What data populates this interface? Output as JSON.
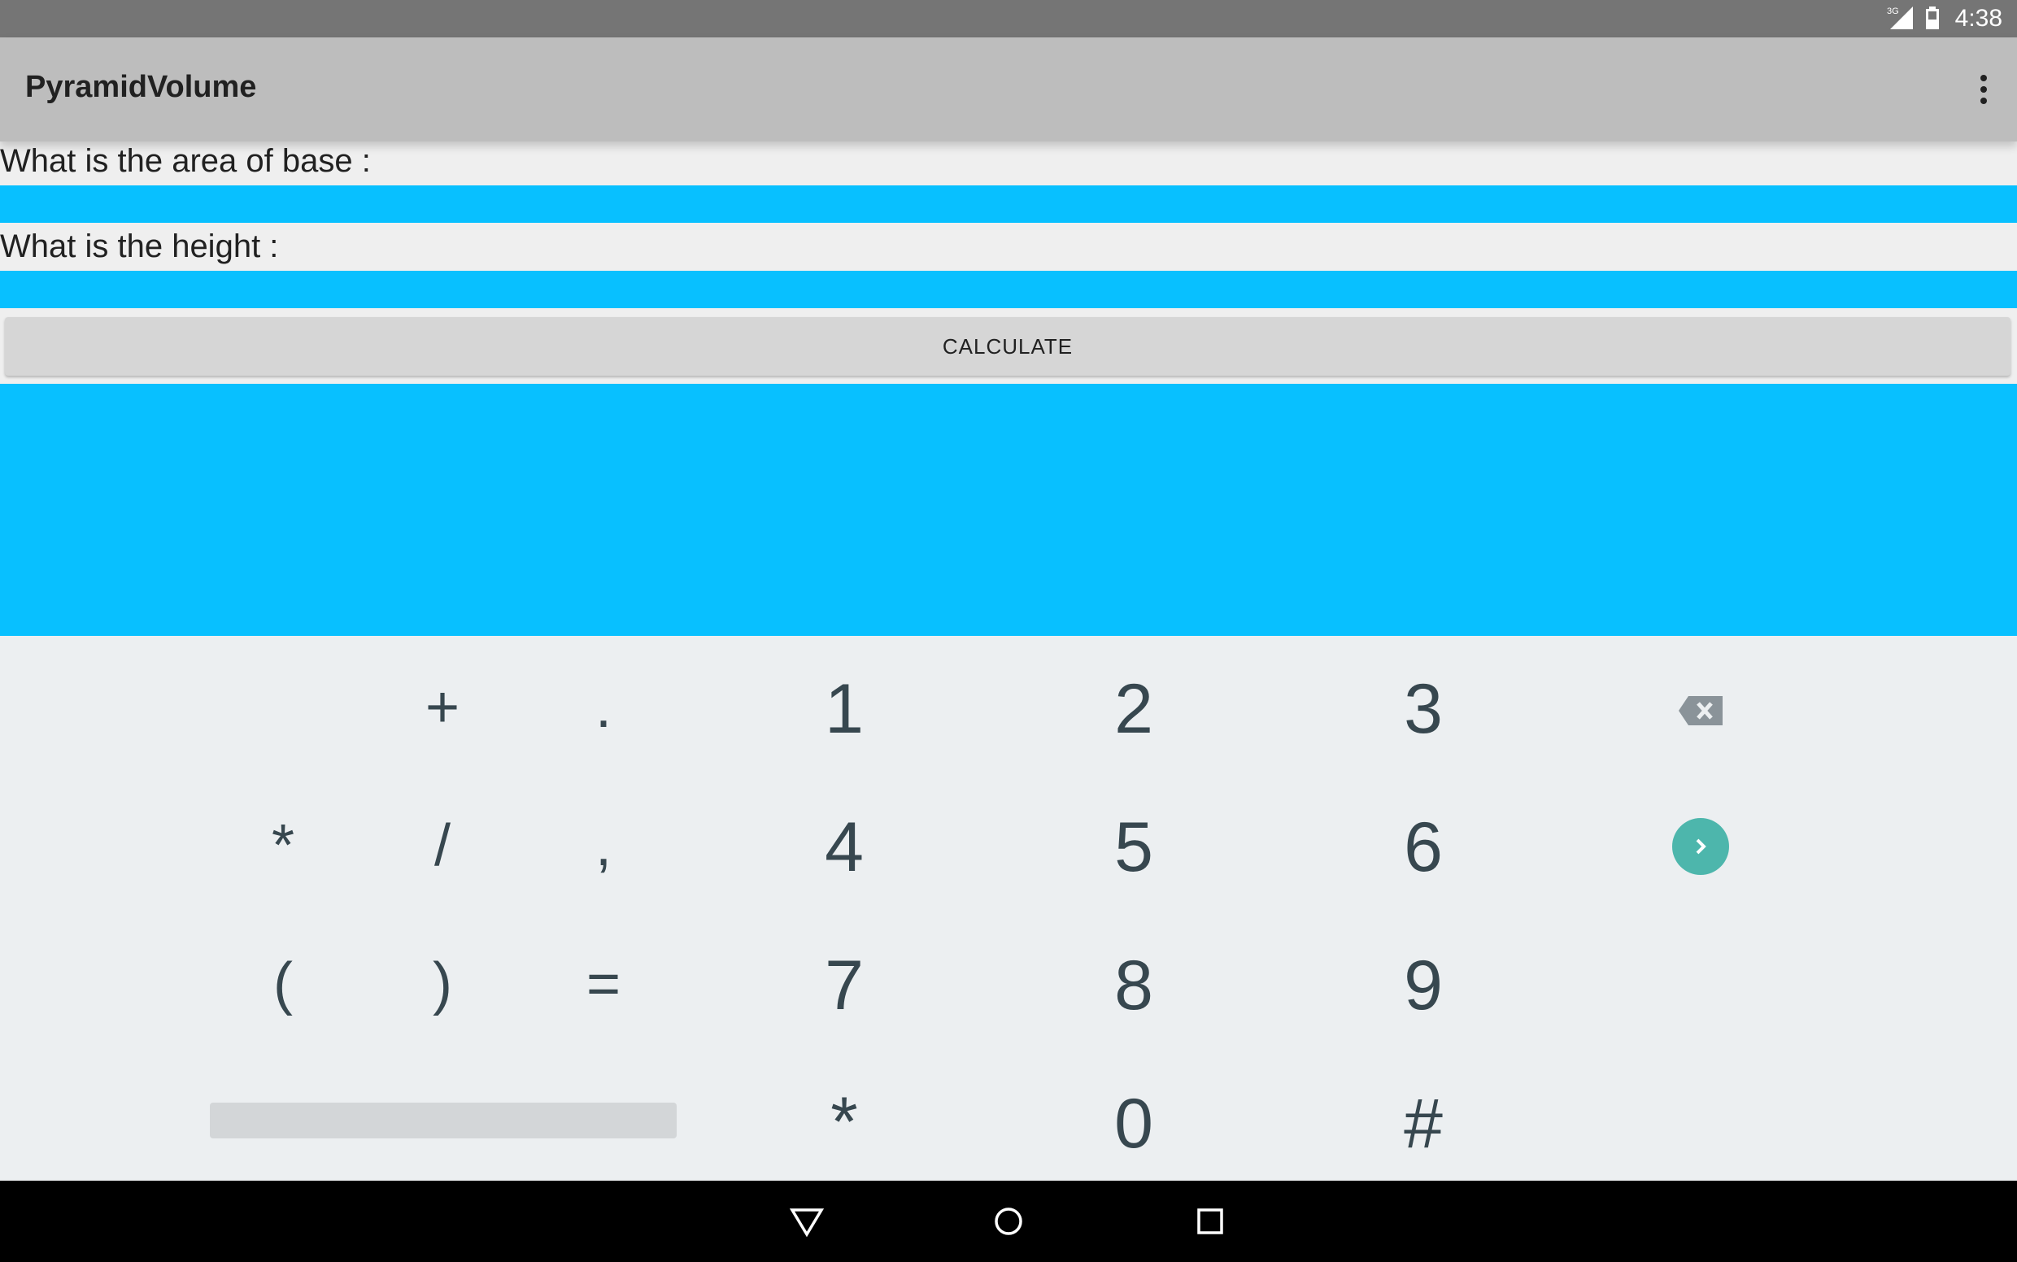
{
  "status_bar": {
    "network": "3G",
    "time": "4:38"
  },
  "app_bar": {
    "title": "PyramidVolume",
    "overflow_icon": "more-vert-icon"
  },
  "form": {
    "base_label": "What is the area of base :",
    "base_value": "",
    "height_label": "What is the height :",
    "height_value": "",
    "calculate_label": "CALCULATE",
    "result_text": "",
    "field_color": "#08c0ff"
  },
  "keyboard": {
    "symbols": [
      "-",
      "+",
      ".",
      "*",
      "/",
      ",",
      "(",
      ")",
      "="
    ],
    "digits": [
      "1",
      "2",
      "3",
      "4",
      "5",
      "6",
      "7",
      "8",
      "9",
      "*",
      "0",
      "#"
    ],
    "delete_icon": "backspace-icon",
    "go_icon": "chevron-right-icon",
    "go_color": "#4db6ac"
  },
  "nav_bar": {
    "back_icon": "back-triangle-icon",
    "home_icon": "home-circle-icon",
    "recents_icon": "recents-square-icon"
  }
}
